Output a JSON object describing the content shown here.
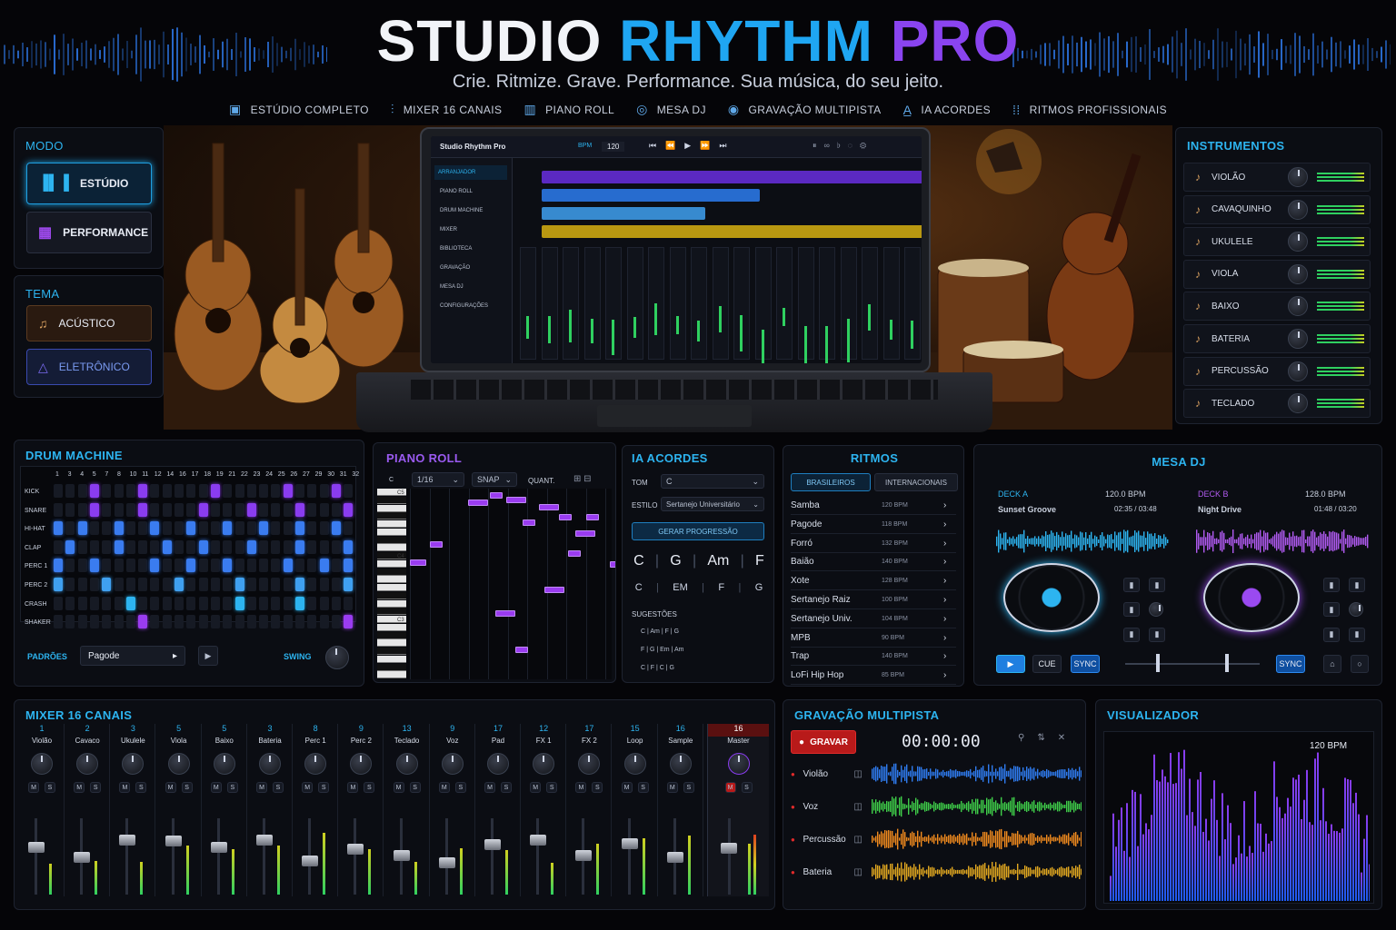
{
  "header": {
    "title_a": "STUDIO ",
    "title_b": "RHYTHM ",
    "title_c": "PRO",
    "subtitle": "Crie. Ritmize. Grave. Performance. Sua música, do seu jeito.",
    "features": [
      {
        "icon": "studio-icon",
        "label": "ESTÚDIO COMPLETO"
      },
      {
        "icon": "mixer-icon",
        "label": "MIXER 16 CANAIS"
      },
      {
        "icon": "piano-roll-icon",
        "label": "PIANO ROLL"
      },
      {
        "icon": "dj-icon",
        "label": "MESA DJ"
      },
      {
        "icon": "record-icon",
        "label": "GRAVAÇÃO MULTIPISTA"
      },
      {
        "icon": "ai-icon",
        "label": "IA ACORDES"
      },
      {
        "icon": "rhythm-icon",
        "label": "RITMOS PROFISSIONAIS"
      }
    ]
  },
  "modo": {
    "title": "MODO",
    "studio": "ESTÚDIO",
    "performance": "PERFORMANCE"
  },
  "tema": {
    "title": "TEMA",
    "acustico": "ACÚSTICO",
    "eletronico": "ELETRÔNICO"
  },
  "laptop": {
    "app": "Studio Rhythm Pro",
    "bpm_label": "BPM",
    "bpm": "120",
    "nav": [
      "ARRANJADOR",
      "PIANO ROLL",
      "DRUM MACHINE",
      "MIXER",
      "BIBLIOTECA",
      "GRAVAÇÃO",
      "MESA DJ",
      "CONFIGURAÇÕES"
    ]
  },
  "instrumentos": {
    "title": "INSTRUMENTOS",
    "items": [
      {
        "name": "VIOLÃO",
        "icon": "guitar-icon"
      },
      {
        "name": "CAVAQUINHO",
        "icon": "guitar-icon"
      },
      {
        "name": "UKULELE",
        "icon": "guitar-icon"
      },
      {
        "name": "VIOLA",
        "icon": "violin-icon"
      },
      {
        "name": "BAIXO",
        "icon": "bass-icon"
      },
      {
        "name": "BATERIA",
        "icon": "drum-icon"
      },
      {
        "name": "PERCUSSÃO",
        "icon": "percussion-icon"
      },
      {
        "name": "TECLADO",
        "icon": "keyboard-icon"
      }
    ]
  },
  "drum": {
    "title": "DRUM MACHINE",
    "steps": [
      "1",
      "3",
      "4",
      "5",
      "7",
      "8",
      "10",
      "11",
      "12",
      "14",
      "16",
      "17",
      "18",
      "19",
      "21",
      "22",
      "23",
      "24",
      "25",
      "26",
      "27",
      "29",
      "30",
      "31",
      "32"
    ],
    "rows": [
      "KICK",
      "SNARE",
      "HI-HAT",
      "CLAP",
      "PERC 1",
      "PERC 2",
      "CRASH",
      "SHAKER"
    ],
    "padroes_label": "PADRÕES",
    "padrao": "Pagode",
    "swing_label": "SWING"
  },
  "piano": {
    "title": "PIANO ROLL",
    "grid": "1/16",
    "snap": "SNAP",
    "quant": "QUANT.",
    "key_top": "C",
    "labels": [
      "C5",
      "C4",
      "C3"
    ]
  },
  "ia": {
    "title": "IA ACORDES",
    "tom_label": "TOM",
    "tom": "C",
    "estilo_label": "ESTILO",
    "estilo": "Sertanejo Universitário",
    "button": "GERAR PROGRESSÃO",
    "chords1": [
      "C",
      "G",
      "Am",
      "F"
    ],
    "chords2": [
      "C",
      "EM",
      "F",
      "G"
    ],
    "sug_label": "SUGESTÕES",
    "sugestoes": [
      "C | Am | F | G",
      "F | G | Em | Am",
      "C | F | C | G"
    ]
  },
  "ritmos": {
    "title": "RITMOS",
    "tab1": "BRASILEIROS",
    "tab2": "INTERNACIONAIS",
    "items": [
      {
        "name": "Samba",
        "bpm": "120 BPM"
      },
      {
        "name": "Pagode",
        "bpm": "118 BPM"
      },
      {
        "name": "Forró",
        "bpm": "132 BPM"
      },
      {
        "name": "Baião",
        "bpm": "140 BPM"
      },
      {
        "name": "Xote",
        "bpm": "128 BPM"
      },
      {
        "name": "Sertanejo Raiz",
        "bpm": "100 BPM"
      },
      {
        "name": "Sertanejo Univ.",
        "bpm": "104 BPM"
      },
      {
        "name": "MPB",
        "bpm": "90 BPM"
      },
      {
        "name": "Trap",
        "bpm": "140 BPM"
      },
      {
        "name": "LoFi Hip Hop",
        "bpm": "85 BPM"
      }
    ]
  },
  "dj": {
    "title": "MESA DJ",
    "deckA": {
      "label": "DECK A",
      "bpm": "120.0 BPM",
      "track": "Sunset Groove",
      "time": "02:35 / 03:48"
    },
    "deckB": {
      "label": "DECK B",
      "bpm": "128.0 BPM",
      "track": "Night Drive",
      "time": "01:48 / 03:20"
    },
    "cue": "CUE",
    "sync": "SYNC"
  },
  "mixer": {
    "title": "MIXER 16 CANAIS",
    "channels": [
      {
        "n": "1",
        "l": "Violão"
      },
      {
        "n": "2",
        "l": "Cavaco"
      },
      {
        "n": "3",
        "l": "Ukulele"
      },
      {
        "n": "5",
        "l": "Viola"
      },
      {
        "n": "5",
        "l": "Baixo"
      },
      {
        "n": "3",
        "l": "Bateria"
      },
      {
        "n": "8",
        "l": "Perc 1"
      },
      {
        "n": "9",
        "l": "Perc 2"
      },
      {
        "n": "13",
        "l": "Teclado"
      },
      {
        "n": "9",
        "l": "Voz"
      },
      {
        "n": "17",
        "l": "Pad"
      },
      {
        "n": "12",
        "l": "FX 1"
      },
      {
        "n": "17",
        "l": "FX 2"
      },
      {
        "n": "15",
        "l": "Loop"
      },
      {
        "n": "16",
        "l": "Sample"
      },
      {
        "n": "16",
        "l": "Master"
      }
    ],
    "m": "M",
    "s": "S"
  },
  "gravacao": {
    "title": "GRAVAÇÃO MULTIPISTA",
    "rec": "GRAVAR",
    "time": "00:00:00",
    "tracks": [
      {
        "name": "Violão",
        "color": "#2f7cf0"
      },
      {
        "name": "Voz",
        "color": "#3fcf4a"
      },
      {
        "name": "Percussão",
        "color": "#f08a1e"
      },
      {
        "name": "Bateria",
        "color": "#e2a820"
      }
    ]
  },
  "visual": {
    "title": "VISUALIZADOR",
    "bpm": "120 BPM"
  },
  "colors": {
    "accent": "#2db4f0",
    "purple": "#8a3cf0",
    "gold": "#e2b010"
  }
}
